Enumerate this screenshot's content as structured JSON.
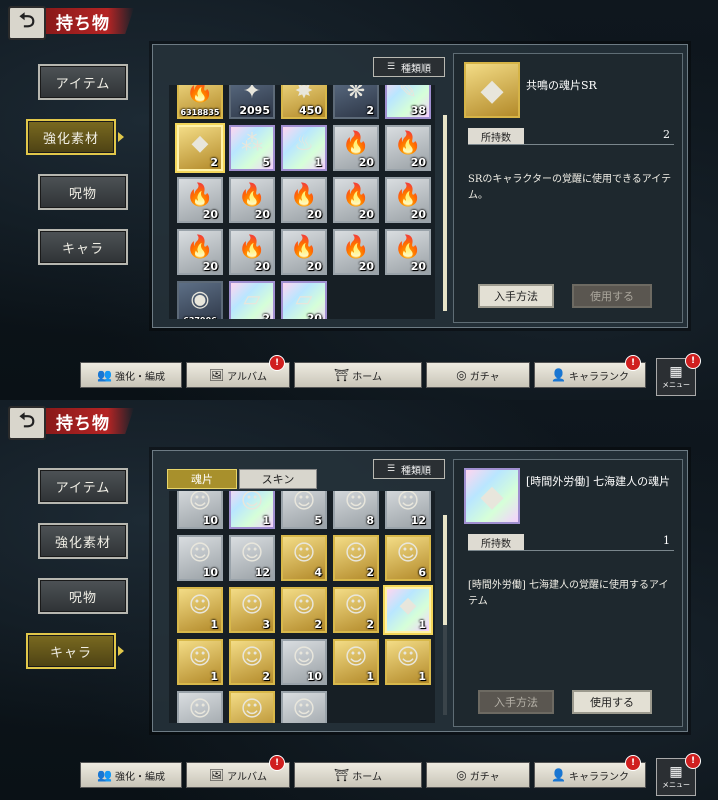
{
  "screens": [
    {
      "header_title": "持ち物",
      "nav": [
        "アイテム",
        "強化素材",
        "呪物",
        "キャラ"
      ],
      "active_nav": 1,
      "sort_label": "種類順",
      "tabs": [],
      "rows": [
        [
          {
            "c": "6318835",
            "t": "gold",
            "g": "🔥"
          },
          {
            "c": "2095",
            "t": "dark",
            "g": "✦"
          },
          {
            "c": "450",
            "t": "gold",
            "g": "✸"
          },
          {
            "c": "2",
            "t": "dark",
            "g": "❋"
          },
          {
            "c": "38",
            "t": "holo",
            "g": "✎"
          }
        ],
        [
          {
            "c": "2",
            "t": "gold",
            "g": "◆",
            "sel": true
          },
          {
            "c": "5",
            "t": "holo",
            "g": "⁂"
          },
          {
            "c": "1",
            "t": "holo",
            "g": "♨"
          },
          {
            "c": "20",
            "t": "silver",
            "g": "🔥"
          },
          {
            "c": "20",
            "t": "silver",
            "g": "🔥"
          }
        ],
        [
          {
            "c": "20",
            "t": "silver",
            "g": "🔥"
          },
          {
            "c": "20",
            "t": "silver",
            "g": "🔥"
          },
          {
            "c": "20",
            "t": "silver",
            "g": "🔥"
          },
          {
            "c": "20",
            "t": "silver",
            "g": "🔥"
          },
          {
            "c": "20",
            "t": "silver",
            "g": "🔥"
          }
        ],
        [
          {
            "c": "20",
            "t": "silver",
            "g": "🔥"
          },
          {
            "c": "20",
            "t": "silver",
            "g": "🔥"
          },
          {
            "c": "20",
            "t": "silver",
            "g": "🔥"
          },
          {
            "c": "20",
            "t": "silver",
            "g": "🔥"
          },
          {
            "c": "20",
            "t": "silver",
            "g": "🔥"
          }
        ],
        [
          {
            "c": "637906",
            "t": "dark",
            "g": "◉"
          },
          {
            "c": "2",
            "t": "holo",
            "g": "▱"
          },
          {
            "c": "20",
            "t": "holo",
            "g": "▱"
          }
        ]
      ],
      "detail": {
        "name": "共鳴の魂片SR",
        "icon": "◆",
        "qty_label": "所持数",
        "qty": "2",
        "desc": "SRのキャラクターの覚醒に使用できるアイテム。",
        "acquire": "入手方法",
        "use": "使用する"
      }
    },
    {
      "header_title": "持ち物",
      "nav": [
        "アイテム",
        "強化素材",
        "呪物",
        "キャラ"
      ],
      "active_nav": 3,
      "sort_label": "種類順",
      "tabs": [
        "魂片",
        "スキン"
      ],
      "rows": [
        [
          {
            "c": "10",
            "t": "silver",
            "g": "☺"
          },
          {
            "c": "1",
            "t": "holo",
            "g": "☺"
          },
          {
            "c": "5",
            "t": "silver",
            "g": "☺"
          },
          {
            "c": "8",
            "t": "silver",
            "g": "☺"
          },
          {
            "c": "12",
            "t": "silver",
            "g": "☺"
          }
        ],
        [
          {
            "c": "10",
            "t": "silver",
            "g": "☺"
          },
          {
            "c": "12",
            "t": "silver",
            "g": "☺"
          },
          {
            "c": "4",
            "t": "gold",
            "g": "☺"
          },
          {
            "c": "2",
            "t": "gold",
            "g": "☺"
          },
          {
            "c": "6",
            "t": "gold",
            "g": "☺"
          }
        ],
        [
          {
            "c": "1",
            "t": "gold",
            "g": "☺"
          },
          {
            "c": "3",
            "t": "gold",
            "g": "☺"
          },
          {
            "c": "2",
            "t": "gold",
            "g": "☺"
          },
          {
            "c": "2",
            "t": "gold",
            "g": "☺"
          },
          {
            "c": "1",
            "t": "holo",
            "g": "◆",
            "sel": true
          }
        ],
        [
          {
            "c": "1",
            "t": "gold",
            "g": "☺"
          },
          {
            "c": "2",
            "t": "gold",
            "g": "☺"
          },
          {
            "c": "10",
            "t": "silver",
            "g": "☺"
          },
          {
            "c": "1",
            "t": "gold",
            "g": "☺"
          },
          {
            "c": "1",
            "t": "gold",
            "g": "☺"
          }
        ],
        [
          {
            "c": "",
            "t": "silver",
            "g": "☺"
          },
          {
            "c": "",
            "t": "gold",
            "g": "☺"
          },
          {
            "c": "",
            "t": "silver",
            "g": "☺"
          }
        ]
      ],
      "detail": {
        "name": "[時間外労働] 七海建人の魂片",
        "icon": "◆",
        "qty_label": "所持数",
        "qty": "1",
        "desc": "[時間外労働] 七海建人の覚醒に使用するアイテム",
        "acquire": "入手方法",
        "use": "使用する"
      }
    }
  ],
  "bottom_nav": [
    {
      "label": "強化・編成",
      "icon": "👥",
      "badge": false
    },
    {
      "label": "アルバム",
      "icon": "🖼",
      "badge": true
    },
    {
      "label": "ホーム",
      "icon": "⛩",
      "badge": false
    },
    {
      "label": "ガチャ",
      "icon": "◎",
      "badge": false
    },
    {
      "label": "キャラランク",
      "icon": "👤",
      "badge": true
    }
  ],
  "menu_label": "メニュー",
  "badge_glyph": "!",
  "back_glyph": "⮌"
}
